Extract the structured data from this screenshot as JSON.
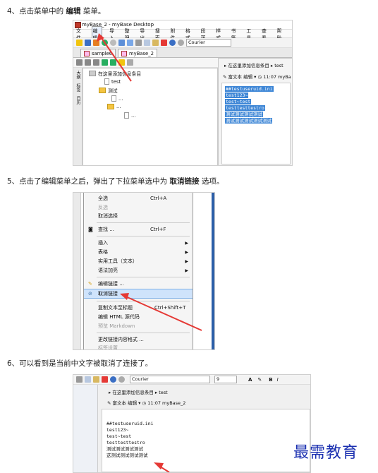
{
  "steps": {
    "s4": {
      "prefix": "4、点击菜单中的 ",
      "bold": "编辑",
      "suffix": " 菜单。"
    },
    "s5": {
      "prefix": "5、点击了编辑菜单之后，弹出了下拉菜单选中为 ",
      "bold": "取消链接",
      "suffix": " 选项。"
    },
    "s6": {
      "text": "6、可以看到是当前中文字被取消了连接了。"
    }
  },
  "shot1": {
    "window_title": "myBase_2 - myBase Desktop",
    "menus": [
      "文件",
      "编辑",
      "导入",
      "整理",
      "导出",
      "搜索",
      "附件",
      "格式",
      "段落",
      "样式",
      "书签",
      "工具",
      "查看",
      "帮助"
    ],
    "font": "Courier",
    "tabs": [
      "sample6",
      "myBase_2"
    ],
    "tree_placeholder": "在这里添加信息条目",
    "tree_items": [
      "test",
      "测试",
      "...",
      "...",
      "..."
    ],
    "crumb_placeholder": "在这里添加信息条目",
    "crumb_item": "test",
    "editor_label": "富文本 编辑",
    "time": "11:07",
    "doc": "myBa",
    "side_tabs": [
      "大纲",
      "标签",
      "日历"
    ],
    "text_lines": [
      "##testuseruid.ini",
      "test123~",
      "test~test",
      "testtesttestro",
      "测试测试测试测试",
      "测试测试测试测试测试"
    ]
  },
  "shot2": {
    "menu_items": [
      {
        "label": "全选",
        "shortcut": "Ctrl+A",
        "disabled": false
      },
      {
        "label": "反选",
        "shortcut": "",
        "disabled": true
      },
      {
        "label": "取消选择",
        "shortcut": "",
        "disabled": false
      },
      {
        "label": "查找 ...",
        "shortcut": "Ctrl+F",
        "disabled": false
      },
      {
        "label": "插入",
        "shortcut": "",
        "disabled": false,
        "submenu": true
      },
      {
        "label": "表格",
        "shortcut": "",
        "disabled": false,
        "submenu": true
      },
      {
        "label": "实用工具（文本）",
        "shortcut": "",
        "disabled": false,
        "submenu": true
      },
      {
        "label": "语法加亮",
        "shortcut": "",
        "disabled": false,
        "submenu": true
      },
      {
        "label": "编辑链接 ...",
        "shortcut": "",
        "disabled": false
      },
      {
        "label": "取消链接",
        "shortcut": "",
        "disabled": false,
        "highlight": true
      },
      {
        "label": "复制文本至标题",
        "shortcut": "Ctrl+Shift+T",
        "disabled": false
      },
      {
        "label": "编辑 HTML 源代码",
        "shortcut": "",
        "disabled": false
      },
      {
        "label": "预览 Markdown",
        "shortcut": "",
        "disabled": true
      },
      {
        "label": "更改链接内容格式 ...",
        "shortcut": "",
        "disabled": false
      },
      {
        "label": "标签设置",
        "shortcut": "",
        "disabled": true
      }
    ]
  },
  "shot3": {
    "font": "Courier",
    "size": "9",
    "crumb_placeholder": "在这里添加信息条目",
    "crumb_item": "test",
    "editor_label": "富文本 编辑",
    "time": "11:07",
    "doc": "myBase_2",
    "text_lines": [
      "##testuseruid.ini",
      "test123~",
      "test~test",
      "testtesttestro",
      "测试测试测试测试",
      "这测试测试测试测试"
    ]
  },
  "watermark": "最需教育",
  "colors": {
    "selection": "#3d86d6",
    "arrow": "#e53935",
    "watermark": "#1a2fb0"
  }
}
